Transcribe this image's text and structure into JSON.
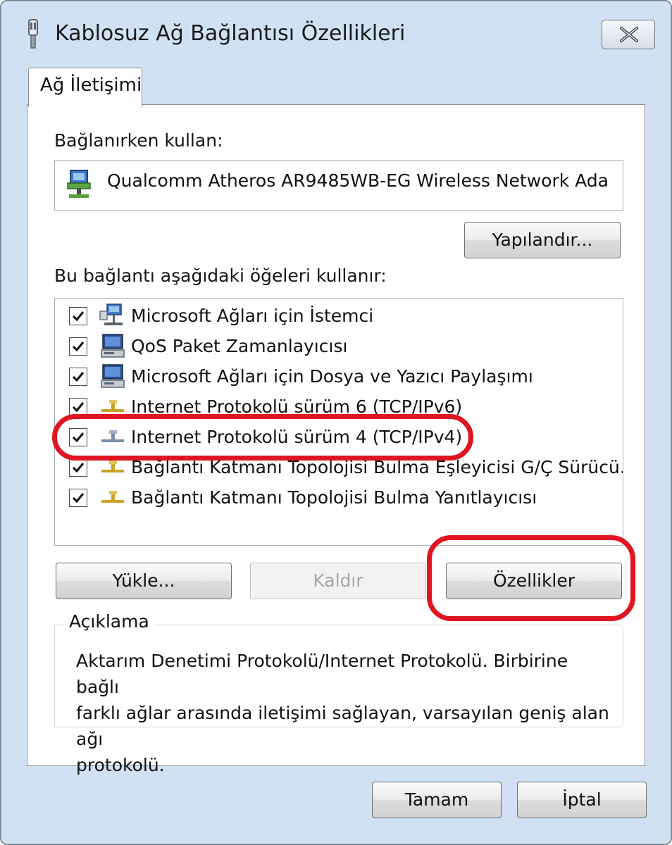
{
  "window": {
    "title": "Kablosuz Ağ Bağlantısı Özellikleri",
    "close_icon": "close-icon"
  },
  "tabs": [
    {
      "label": "Ağ İletişimi",
      "selected": true
    }
  ],
  "connect_using": {
    "label": "Bağlanırken kullan:",
    "adapter_name": "Qualcomm Atheros AR9485WB-EG Wireless Network Ada",
    "adapter_icon": "network-adapter-icon",
    "configure_label": "Yapılandır..."
  },
  "items_section": {
    "label": "Bu bağlantı aşağıdaki öğeleri kullanır:",
    "items": [
      {
        "label": "Microsoft Ağları için İstemci",
        "checked": true,
        "icon": "network-client-icon"
      },
      {
        "label": "QoS Paket Zamanlayıcısı",
        "checked": true,
        "icon": "service-computer-icon"
      },
      {
        "label": "Microsoft Ağları için Dosya ve Yazıcı Paylaşımı",
        "checked": true,
        "icon": "service-computer-icon"
      },
      {
        "label": "Internet Protokolü sürüm 6 (TCP/IPv6)",
        "checked": true,
        "icon": "protocol-icon"
      },
      {
        "label": "Internet Protokolü sürüm 4 (TCP/IPv4)",
        "checked": true,
        "icon": "protocol-icon",
        "highlighted": true
      },
      {
        "label": "Bağlantı Katmanı Topolojisi Bulma Eşleyicisi G/Ç Sürücü...",
        "checked": true,
        "icon": "protocol-icon"
      },
      {
        "label": "Bağlantı Katmanı Topolojisi Bulma Yanıtlayıcısı",
        "checked": true,
        "icon": "protocol-icon"
      }
    ]
  },
  "item_buttons": {
    "install": "Yükle...",
    "uninstall": "Kaldır",
    "uninstall_disabled": true,
    "properties": "Özellikler",
    "properties_highlighted": true
  },
  "description": {
    "legend": "Açıklama",
    "lines": [
      "Aktarım Denetimi Protokolü/Internet Protokolü. Birbirine bağlı",
      "farklı ağlar arasında iletişimi sağlayan, varsayılan geniş alan ağı",
      "protokolü."
    ]
  },
  "footer": {
    "ok": "Tamam",
    "cancel": "İptal"
  },
  "colors": {
    "annotation": "#e01522",
    "window_frame": "#cfe1f3"
  }
}
